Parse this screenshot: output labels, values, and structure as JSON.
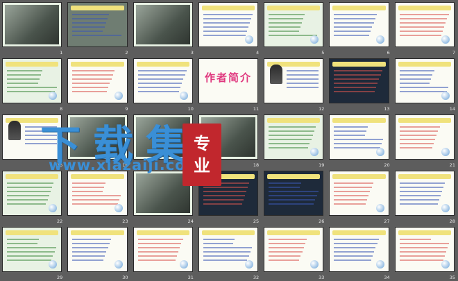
{
  "slides": [
    {
      "num": "1",
      "variant": "photo"
    },
    {
      "num": "2",
      "variant": "gray"
    },
    {
      "num": "3",
      "variant": "photo"
    },
    {
      "num": "4",
      "variant": "white"
    },
    {
      "num": "5",
      "variant": "green"
    },
    {
      "num": "6",
      "variant": "white"
    },
    {
      "num": "7",
      "variant": "white"
    },
    {
      "num": "8",
      "variant": "green"
    },
    {
      "num": "9",
      "variant": "white"
    },
    {
      "num": "10",
      "variant": "white"
    },
    {
      "num": "11",
      "variant": "title",
      "title": "作者简介"
    },
    {
      "num": "12",
      "variant": "portrait"
    },
    {
      "num": "13",
      "variant": "dark"
    },
    {
      "num": "14",
      "variant": "white"
    },
    {
      "num": "15",
      "variant": "portrait"
    },
    {
      "num": "16",
      "variant": "photo"
    },
    {
      "num": "17",
      "variant": "photo"
    },
    {
      "num": "18",
      "variant": "photo"
    },
    {
      "num": "19",
      "variant": "green"
    },
    {
      "num": "20",
      "variant": "white"
    },
    {
      "num": "21",
      "variant": "white"
    },
    {
      "num": "22",
      "variant": "green"
    },
    {
      "num": "23",
      "variant": "white"
    },
    {
      "num": "24",
      "variant": "photo"
    },
    {
      "num": "25",
      "variant": "dark"
    },
    {
      "num": "26",
      "variant": "dark"
    },
    {
      "num": "27",
      "variant": "white"
    },
    {
      "num": "28",
      "variant": "white"
    },
    {
      "num": "29",
      "variant": "green"
    },
    {
      "num": "30",
      "variant": "white"
    },
    {
      "num": "31",
      "variant": "white"
    },
    {
      "num": "32",
      "variant": "white"
    },
    {
      "num": "33",
      "variant": "white"
    },
    {
      "num": "34",
      "variant": "white"
    },
    {
      "num": "35",
      "variant": "white"
    }
  ],
  "watermark": {
    "main": "下载集",
    "url": "www.xiazaiji.com",
    "badge_1": "专",
    "badge_2": "业"
  },
  "colors": {
    "background": "#5d5d5d",
    "watermark_blue": "#3a8fd6",
    "badge_red": "#c1272d",
    "title_pink": "#e0377e"
  }
}
